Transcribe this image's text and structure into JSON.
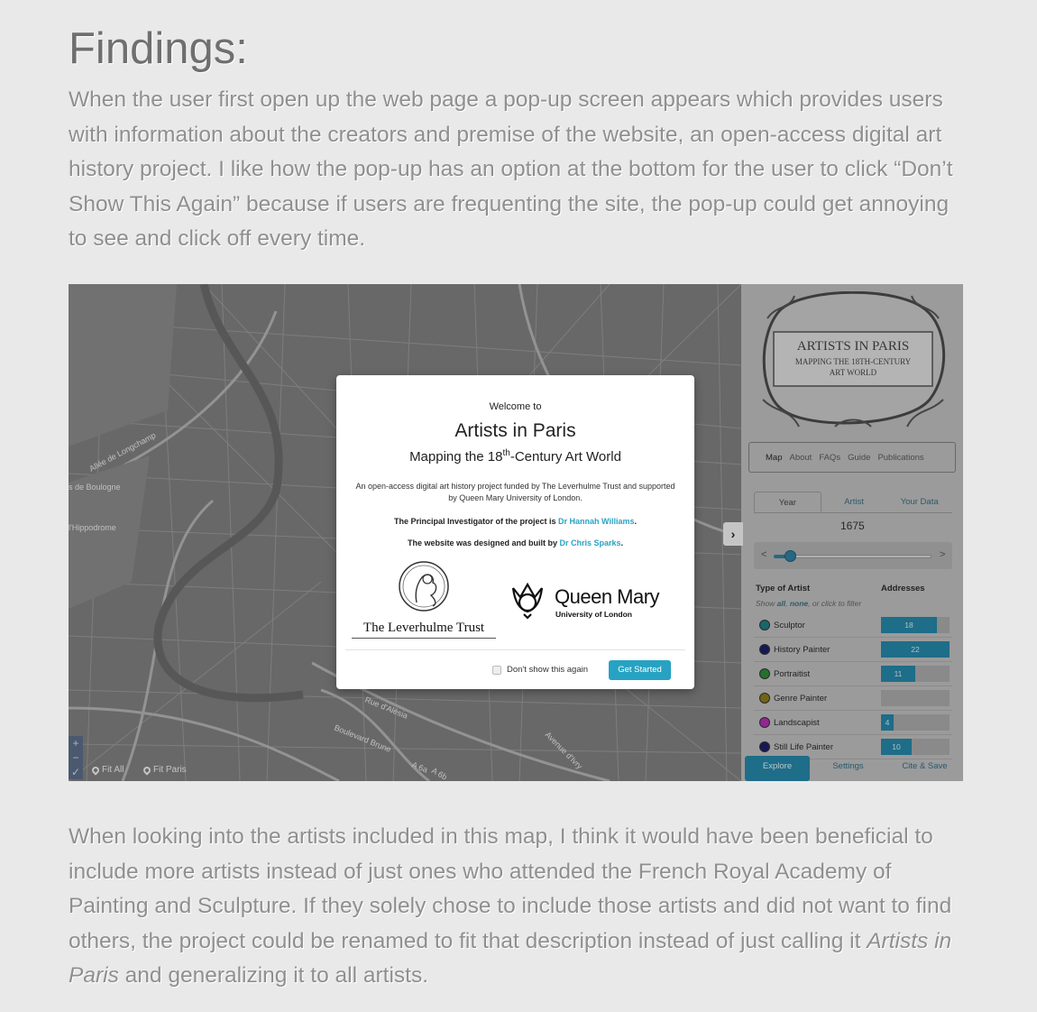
{
  "heading": "Findings:",
  "paragraph1": "When the user first open up the web page a pop-up screen appears which provides users with information about the creators and premise of the website, an open-access digital art history project. I like how the pop-up has an option at the bottom for the user to click “Don’t Show This Again” because if users are frequenting the site, the pop-up could get annoying to see and click off every time.",
  "paragraph2": {
    "before": "When looking into the artists included in this map, I think it would have been beneficial to include more artists instead of just ones who attended the French Royal Academy of Painting and Sculpture. If they solely chose to include those artists and did not want to find others, the project could be renamed to fit that description instead of just calling it ",
    "emphasis": "Artists in Paris",
    "after": " and generalizing it to all artists."
  },
  "map": {
    "street_labels": [
      "Allée de Longchamp",
      "s de Boulogne",
      "l'Hippodrome",
      "Rue d'Alésia",
      "Boulevard Brune",
      "Avenue d'Ivry",
      "A 6a",
      "A 6b"
    ],
    "zoom_in": "+",
    "zoom_out": "−",
    "fit_all": "Fit All",
    "fit_paris": "Fit Paris",
    "sidebar_toggle": "›"
  },
  "sidebar": {
    "logo": {
      "title": "ARTISTS IN PARIS",
      "subtitle": "MAPPING THE 18TH-CENTURY",
      "subtitle2": "ART WORLD"
    },
    "nav": [
      "Map",
      "About",
      "FAQs",
      "Guide",
      "Publications"
    ],
    "tabs": [
      "Year",
      "Artist",
      "Your Data"
    ],
    "year": "1675",
    "slider": {
      "prev": "<",
      "next": ">",
      "position": 0.1
    },
    "type_header": "Type of Artist",
    "addresses_header": "Addresses",
    "filter_note": {
      "show": "Show ",
      "all": "all",
      "comma": ", ",
      "none": "none",
      "rest": ", or click to filter"
    },
    "artists": [
      {
        "name": "Sculptor",
        "color": "#1f7d86",
        "count": "18",
        "fraction": 0.82
      },
      {
        "name": "History Painter",
        "color": "#1b1f66",
        "count": "22",
        "fraction": 1.0
      },
      {
        "name": "Portraitist",
        "color": "#2d8a3a",
        "count": "11",
        "fraction": 0.5
      },
      {
        "name": "Genre Painter",
        "color": "#8a7a1a",
        "count": "",
        "fraction": 0
      },
      {
        "name": "Landscapist",
        "color": "#b22fb3",
        "count": "4",
        "fraction": 0.18
      },
      {
        "name": "Still Life Painter",
        "color": "#1b1f66",
        "count": "10",
        "fraction": 0.45
      }
    ],
    "bottom_tabs": [
      "Explore",
      "Settings",
      "Cite & Save"
    ]
  },
  "modal": {
    "welcome": "Welcome to",
    "title": "Artists in Paris",
    "subtitle_before": "Mapping the 18",
    "subtitle_sup": "th",
    "subtitle_after": "-Century Art World",
    "description": "An open-access digital art history project funded by The Leverhulme Trust and supported by Queen Mary University of London.",
    "pi_text": "The Principal Investigator of the project is ",
    "pi_name": "Dr Hannah Williams",
    "pi_end": ".",
    "site_text": "The website was designed and built by ",
    "site_name": "Dr Chris Sparks",
    "site_end": ".",
    "leverhulme": "The Leverhulme Trust",
    "queen_mary": "Queen Mary",
    "queen_mary_sub": "University of London",
    "dont_show": "Don't show this again",
    "get_started": "Get Started"
  }
}
